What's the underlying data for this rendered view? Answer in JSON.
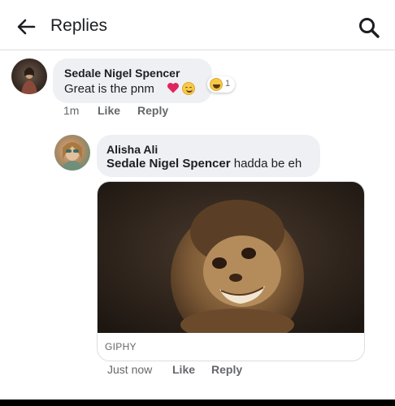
{
  "header": {
    "title": "Replies",
    "back_icon": "back-arrow-icon",
    "search_icon": "search-icon"
  },
  "comments": [
    {
      "author": "Sedale Nigel Spencer",
      "text": "Great is the pnm",
      "emojis": [
        "heart-icon",
        "smiling-face-icon"
      ],
      "reaction": {
        "icon": "haha-reaction-icon",
        "count": "1"
      },
      "time": "1m",
      "like_label": "Like",
      "reply_label": "Reply"
    },
    {
      "author": "Alisha Ali",
      "mention": "Sedale Nigel Spencer",
      "text": "hadda be eh",
      "attachment": {
        "type": "gif",
        "source_label": "GIPHY"
      },
      "time": "Just now",
      "like_label": "Like",
      "reply_label": "Reply"
    }
  ],
  "colors": {
    "bubble": "#eef0f3",
    "meta_text": "#65676b",
    "heart": "#e0245e"
  }
}
